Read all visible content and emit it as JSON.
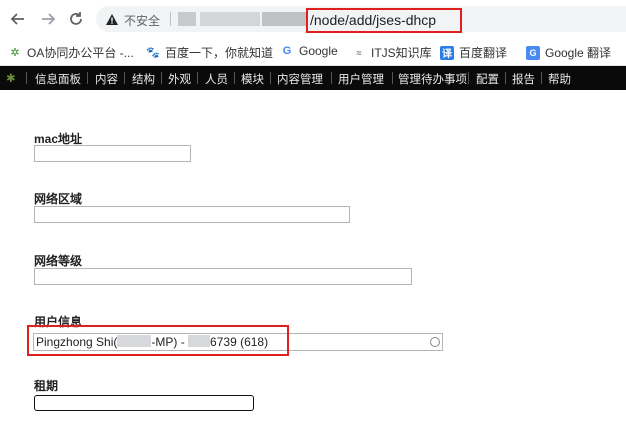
{
  "browser": {
    "back_icon": "back-arrow-icon",
    "forward_icon": "forward-arrow-icon",
    "reload_icon": "reload-icon",
    "security_label": "不安全",
    "url_path": "/node/add/jses-dhcp"
  },
  "bookmarks": [
    {
      "label": "OA协同办公平台 -...",
      "icon": "oa-logo-icon",
      "color": "#3a8a2e"
    },
    {
      "label": "百度一下，你就知道",
      "icon": "baidu-paw-icon",
      "color": "#2a6ee8"
    },
    {
      "label": "Google",
      "icon": "google-g-icon",
      "color": "#4285f4"
    },
    {
      "label": "ITJS知识库",
      "icon": "itjs-icon",
      "color": "#7a7a7a"
    },
    {
      "label": "百度翻译",
      "icon": "translate-icon",
      "color": "#2b7de9"
    },
    {
      "label": "Google 翻译",
      "icon": "google-translate-icon",
      "color": "#4a8af4"
    }
  ],
  "admin_menu": [
    "信息面板",
    "内容",
    "结构",
    "外观",
    "人员",
    "模块",
    "内容管理",
    "用户管理",
    "管理待办事项",
    "配置",
    "报告",
    "帮助"
  ],
  "form": {
    "mac_label": "mac地址",
    "zone_label": "网络区域",
    "level_label": "网络等级",
    "user_label": "用户信息",
    "user_value_a": "Pingzhong Shi(",
    "user_value_b": "-MP) - ",
    "user_value_c": "6739 (618)",
    "lease_label": "租期"
  },
  "colors": {
    "highlight": "#e0201e",
    "toolbar_bg": "#0a0a0a"
  }
}
